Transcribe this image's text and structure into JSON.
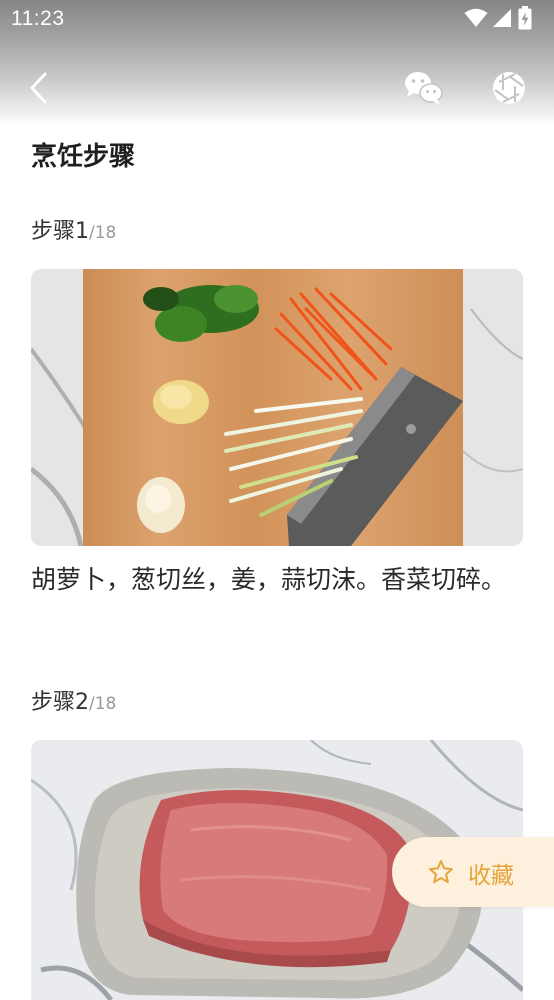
{
  "status_bar": {
    "time": "11:23",
    "icons": [
      "wifi-icon",
      "cellular-signal-icon",
      "battery-charging-icon"
    ]
  },
  "nav": {
    "back_icon": "chevron-left-icon",
    "share_wechat_icon": "wechat-icon",
    "share_moments_icon": "moments-aperture-icon"
  },
  "recipe": {
    "section_title": "烹饪步骤",
    "steps": [
      {
        "label": "步骤1",
        "total": "/18",
        "image": "chopped carrot, scallion, ginger, garlic and cilantro on a wooden cutting board",
        "text": "胡萝卜，葱切丝，姜，蒜切沫。香菜切碎。"
      },
      {
        "label": "步骤2",
        "total": "/18",
        "image": "raw pork tenderloin on a grey oval plate",
        "text": ""
      }
    ]
  },
  "favorite": {
    "label": "收藏",
    "icon": "star-outline-icon"
  },
  "colors": {
    "accent": "#e6a43a",
    "favorite_bg": "#fdf0dc",
    "text_primary": "#1f1f1f",
    "text_muted": "#999999"
  }
}
